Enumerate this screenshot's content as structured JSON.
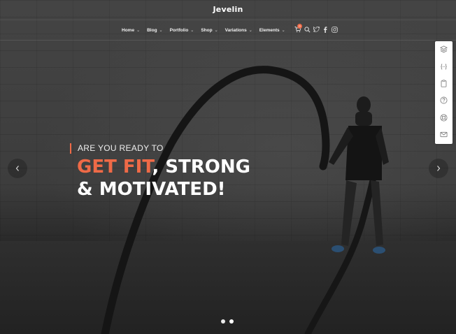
{
  "brand": {
    "logo_text": "Jevelin",
    "accent_color": "#ef6a47"
  },
  "nav": {
    "items": [
      {
        "label": "Home"
      },
      {
        "label": "Blog"
      },
      {
        "label": "Portfolio"
      },
      {
        "label": "Shop"
      },
      {
        "label": "Variations"
      },
      {
        "label": "Elements"
      }
    ],
    "icons": [
      "cart-icon",
      "search-icon",
      "twitter-icon",
      "facebook-icon",
      "instagram-icon"
    ],
    "cart_count": "0"
  },
  "sidebar": {
    "icons": [
      "layers-icon",
      "code-icon",
      "clipboard-icon",
      "help-icon",
      "support-icon",
      "mail-icon"
    ]
  },
  "hero": {
    "pre_title": "ARE YOU READY TO",
    "headline_accent": "GET FIT",
    "headline_rest": ", STRONG",
    "headline_line2": "& MOTIVATED!"
  },
  "slider": {
    "dots": 2,
    "active_dot": 1
  }
}
